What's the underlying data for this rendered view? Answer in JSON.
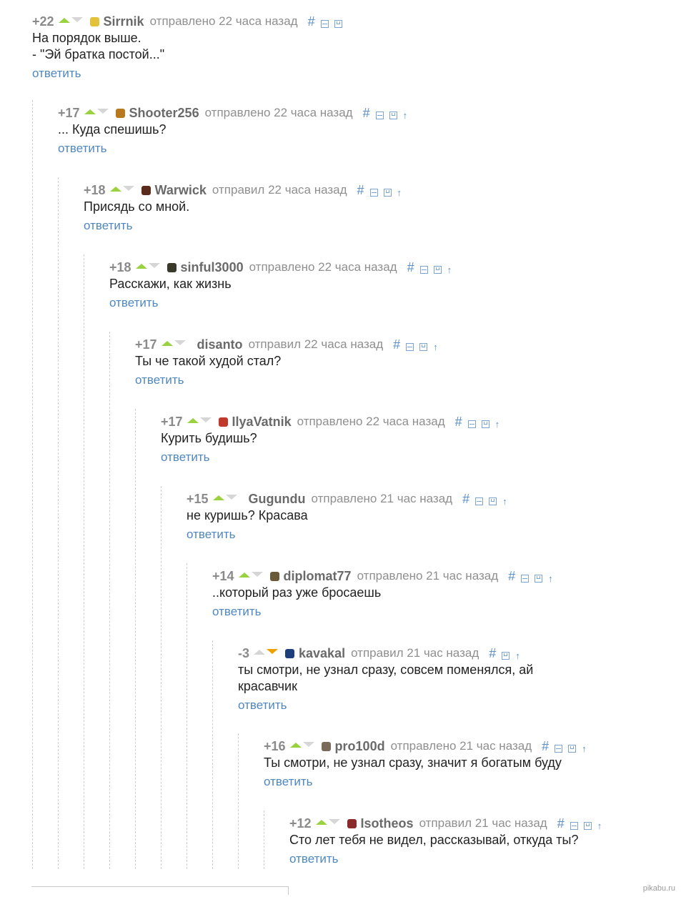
{
  "ui": {
    "reply_label": "ответить",
    "hash_label": "#",
    "watermark": "pikabu.ru",
    "colors": {
      "up_active": "#9ad23f",
      "down_active": "#f0a000",
      "link": "#4f87c0"
    }
  },
  "comments": [
    {
      "rating": "+22",
      "author": "Sirrnik",
      "meta": "отправлено 22 часа назад",
      "text": "На порядок выше.\n- \"Эй братка постой...\"",
      "avatar_color": "#e2c23a",
      "vote": "up",
      "parent_link": false,
      "collapse": true
    },
    {
      "rating": "+17",
      "author": "Shooter256",
      "meta": "отправлено 22 часа назад",
      "text": "... Куда спешишь?",
      "avatar_color": "#b8791e",
      "vote": "up",
      "parent_link": true,
      "collapse": true
    },
    {
      "rating": "+18",
      "author": "Warwick",
      "meta": "отправил 22 часа назад",
      "text": "Присядь со мной.",
      "avatar_color": "#5a2a1a",
      "vote": "up",
      "parent_link": true,
      "collapse": true
    },
    {
      "rating": "+18",
      "author": "sinful3000",
      "meta": "отправлено 22 часа назад",
      "text": "Расскажи, как жизнь",
      "avatar_color": "#3a3a2a",
      "vote": "up",
      "parent_link": true,
      "collapse": true
    },
    {
      "rating": "+17",
      "author": "disanto",
      "meta": "отправил 22 часа назад",
      "text": "Ты че такой худой стал?",
      "avatar_color": "",
      "vote": "up",
      "parent_link": true,
      "collapse": true
    },
    {
      "rating": "+17",
      "author": "IlyaVatnik",
      "meta": "отправлено 22 часа назад",
      "text": "Курить будишь?",
      "avatar_color": "#c0392b",
      "vote": "up",
      "parent_link": true,
      "collapse": true
    },
    {
      "rating": "+15",
      "author": "Gugundu",
      "meta": "отправлено 21 час назад",
      "text": "не куришь? Красава",
      "avatar_color": "",
      "vote": "up",
      "parent_link": true,
      "collapse": true
    },
    {
      "rating": "+14",
      "author": "diplomat77",
      "meta": "отправлено 21 час назад",
      "text": "..который раз уже бросаешь",
      "avatar_color": "#6b5a3a",
      "vote": "up",
      "parent_link": true,
      "collapse": true
    },
    {
      "rating": "-3",
      "author": "kavakal",
      "meta": "отправил 21 час назад",
      "text": "ты смотри, не узнал сразу, совсем поменялся, ай\nкрасавчик",
      "avatar_color": "#1f3f7a",
      "vote": "down",
      "parent_link": true,
      "collapse": false
    },
    {
      "rating": "+16",
      "author": "pro100d",
      "meta": "отправлено 21 час назад",
      "text": "Ты смотри, не узнал сразу, значит я богатым буду",
      "avatar_color": "#7a6a5a",
      "vote": "up",
      "parent_link": true,
      "collapse": true
    },
    {
      "rating": "+12",
      "author": "Isotheos",
      "meta": "отправил 21 час назад",
      "text": "Сто лет тебя не видел, рассказывай, откуда ты?",
      "avatar_color": "#8a2a2a",
      "vote": "up",
      "parent_link": true,
      "collapse": true
    }
  ]
}
